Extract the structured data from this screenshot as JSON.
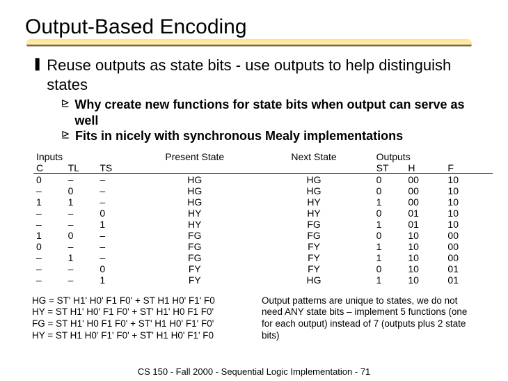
{
  "title": "Output-Based Encoding",
  "main_point": "Reuse outputs as state bits - use outputs to help distinguish states",
  "sub_points": [
    "Why create new functions for state bits when output can serve as well",
    "Fits in nicely with synchronous Mealy implementations"
  ],
  "table": {
    "head_inputs": "Inputs",
    "head_present": "Present State",
    "head_next": "Next State",
    "head_outputs": "Outputs",
    "cols": {
      "c": "C",
      "tl": "TL",
      "ts": "TS",
      "st": "ST",
      "h": "H",
      "f": "F"
    },
    "rows": [
      {
        "c": "0",
        "tl": "–",
        "ts": "–",
        "ps": "HG",
        "ns": "HG",
        "st": "0",
        "h": "00",
        "f": "10"
      },
      {
        "c": "–",
        "tl": "0",
        "ts": "–",
        "ps": "HG",
        "ns": "HG",
        "st": "0",
        "h": "00",
        "f": "10"
      },
      {
        "c": "1",
        "tl": "1",
        "ts": "–",
        "ps": "HG",
        "ns": "HY",
        "st": "1",
        "h": "00",
        "f": "10"
      },
      {
        "c": "–",
        "tl": "–",
        "ts": "0",
        "ps": "HY",
        "ns": "HY",
        "st": "0",
        "h": "01",
        "f": "10"
      },
      {
        "c": "–",
        "tl": "–",
        "ts": "1",
        "ps": "HY",
        "ns": "FG",
        "st": "1",
        "h": "01",
        "f": "10"
      },
      {
        "c": "1",
        "tl": "0",
        "ts": "–",
        "ps": "FG",
        "ns": "FG",
        "st": "0",
        "h": "10",
        "f": "00"
      },
      {
        "c": "0",
        "tl": "–",
        "ts": "–",
        "ps": "FG",
        "ns": "FY",
        "st": "1",
        "h": "10",
        "f": "00"
      },
      {
        "c": "–",
        "tl": "1",
        "ts": "–",
        "ps": "FG",
        "ns": "FY",
        "st": "1",
        "h": "10",
        "f": "00"
      },
      {
        "c": "–",
        "tl": "–",
        "ts": "0",
        "ps": "FY",
        "ns": "FY",
        "st": "0",
        "h": "10",
        "f": "01"
      },
      {
        "c": "–",
        "tl": "–",
        "ts": "1",
        "ps": "FY",
        "ns": "HG",
        "st": "1",
        "h": "10",
        "f": "01"
      }
    ]
  },
  "notes_left": [
    "HG = ST' H1' H0' F1 F0' + ST H1 H0' F1' F0",
    "HY = ST H1' H0' F1 F0' + ST' H1' H0 F1 F0'",
    "FG = ST H1' H0 F1 F0' + ST' H1 H0' F1' F0'",
    "HY = ST H1 H0' F1' F0' + ST' H1 H0' F1' F0"
  ],
  "notes_right": "Output patterns are unique to states, we do not need ANY state bits – implement 5 functions (one for each output) instead of 7 (outputs plus 2 state bits)",
  "footer": "CS 150 - Fall 2000 - Sequential Logic Implementation - 71"
}
